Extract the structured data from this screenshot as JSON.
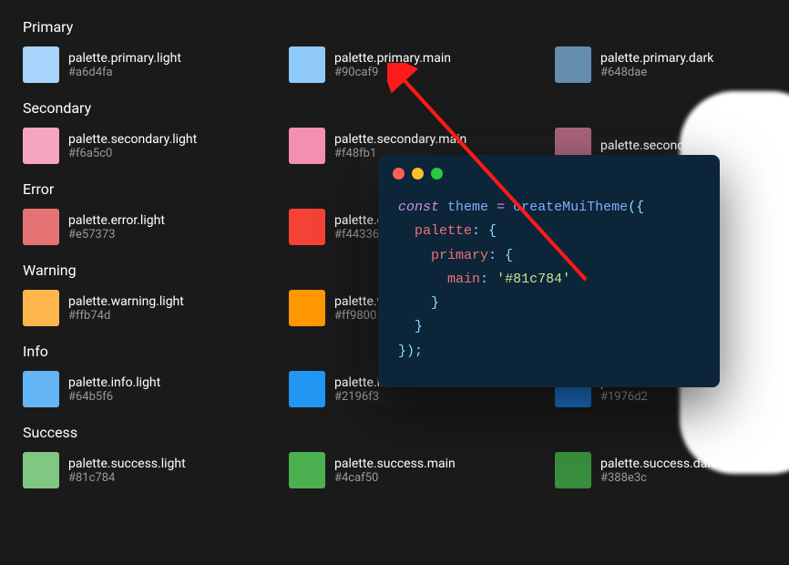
{
  "categories": [
    {
      "title": "Primary",
      "swatches": [
        {
          "label": "palette.primary.light",
          "hex": "#a6d4fa",
          "color": "#a6d4fa"
        },
        {
          "label": "palette.primary.main",
          "hex": "#90caf9",
          "color": "#90caf9"
        },
        {
          "label": "palette.primary.dark",
          "hex": "#648dae",
          "color": "#648dae"
        }
      ]
    },
    {
      "title": "Secondary",
      "swatches": [
        {
          "label": "palette.secondary.light",
          "hex": "#f6a5c0",
          "color": "#f6a5c0"
        },
        {
          "label": "palette.secondary.main",
          "hex": "#f48fb1",
          "color": "#f48fb1"
        },
        {
          "label": "palette.secondary.dark",
          "hex": "",
          "color": "#aa647b"
        }
      ]
    },
    {
      "title": "Error",
      "swatches": [
        {
          "label": "palette.error.light",
          "hex": "#e57373",
          "color": "#e57373"
        },
        {
          "label": "palette.error.main",
          "hex": "#f44336",
          "color": "#f44336"
        },
        {
          "label": "",
          "hex": "",
          "color": ""
        }
      ]
    },
    {
      "title": "Warning",
      "swatches": [
        {
          "label": "palette.warning.light",
          "hex": "#ffb74d",
          "color": "#ffb74d"
        },
        {
          "label": "palette.warning.main",
          "hex": "#ff9800",
          "color": "#ff9800"
        },
        {
          "label": "",
          "hex": "",
          "color": ""
        }
      ]
    },
    {
      "title": "Info",
      "swatches": [
        {
          "label": "palette.info.light",
          "hex": "#64b5f6",
          "color": "#64b5f6"
        },
        {
          "label": "palette.info.main",
          "hex": "#2196f3",
          "color": "#2196f3"
        },
        {
          "label": "palette.info.dark",
          "hex": "#1976d2",
          "color": "#1976d2"
        }
      ]
    },
    {
      "title": "Success",
      "swatches": [
        {
          "label": "palette.success.light",
          "hex": "#81c784",
          "color": "#81c784"
        },
        {
          "label": "palette.success.main",
          "hex": "#4caf50",
          "color": "#4caf50"
        },
        {
          "label": "palette.success.dark",
          "hex": "#388e3c",
          "color": "#388e3c"
        }
      ]
    }
  ],
  "code": {
    "keyword": "const",
    "varname": "theme",
    "op": "=",
    "fn": "createMuiTheme",
    "open_paren": "({",
    "prop_palette": "palette",
    "colon_brace": ": {",
    "prop_primary": "primary",
    "prop_main": "main",
    "colon": ":",
    "string_value": "'#81c784'",
    "close_brace": "}",
    "close_all": "});"
  }
}
